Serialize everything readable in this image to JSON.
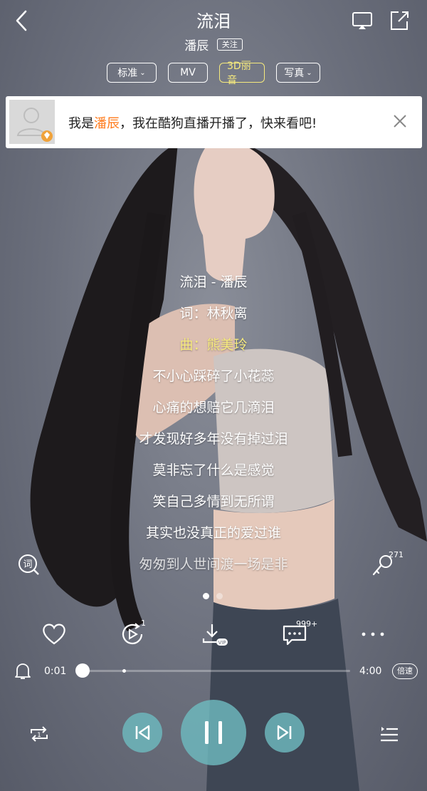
{
  "header": {
    "back_icon": "chevron-left-icon",
    "song_title": "流泪",
    "artist": "潘辰",
    "follow_label": "关注",
    "cast_icon": "screen-cast-icon",
    "share_icon": "share-external-icon"
  },
  "chips": [
    {
      "label": "标准",
      "caret": "⌄"
    },
    {
      "label": "MV",
      "caret": ""
    },
    {
      "label": "3D丽音",
      "caret": ""
    },
    {
      "label": "写真",
      "caret": "⌄"
    }
  ],
  "banner": {
    "prefix": "我是",
    "highlight": "潘辰",
    "suffix": "，我在酷狗直播开播了，快来看吧!",
    "highlight_color": "#ff7a1a"
  },
  "lyrics": {
    "active_color": "#f6ea7e",
    "lines": [
      "流泪 - 潘辰",
      "词：林秋离",
      "曲：熊美玲",
      "不小心踩碎了小花蕊",
      "心痛的想赔它几滴泪",
      "才发现好多年没有掉过泪",
      "莫非忘了什么是感觉",
      "笑自己多情到无所谓",
      "其实也没真正的爱过谁",
      "匆匆到人世间渡一场是非"
    ],
    "active_index": 2
  },
  "side_buttons": {
    "lyrics_icon": "lyrics-search-icon",
    "lyrics_glyph": "词",
    "sing_icon": "microphone-icon",
    "sing_count": "271"
  },
  "pager": {
    "total": 2,
    "current": 0
  },
  "actions": {
    "like_icon": "heart-icon",
    "video_icon": "video-play-icon",
    "video_count": "1",
    "download_icon": "download-vip-icon",
    "download_tag": "VIP",
    "comment_icon": "comment-icon",
    "comment_count": "999+",
    "more_icon": "more-dots-icon"
  },
  "progress": {
    "alarm_icon": "bell-icon",
    "current_time": "0:01",
    "total_time": "4:00",
    "played_fraction": 0.004,
    "speed_label": "倍速"
  },
  "controls": {
    "repeat_icon": "repeat-one-icon",
    "repeat_glyph": "1",
    "prev_icon": "previous-icon",
    "pause_icon": "pause-icon",
    "next_icon": "next-icon",
    "playlist_icon": "playlist-icon",
    "button_color": "#6eb9be"
  }
}
